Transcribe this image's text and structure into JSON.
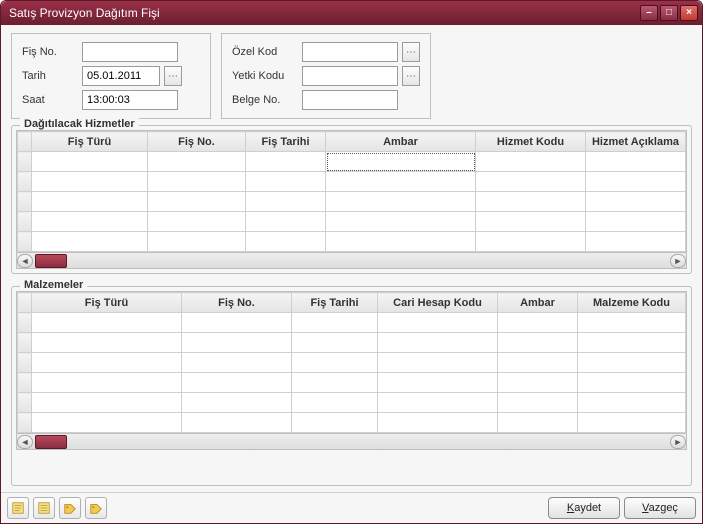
{
  "window": {
    "title": "Satış Provizyon Dağıtım Fişi"
  },
  "form_left": {
    "fis_no": {
      "label": "Fiş No.",
      "value": ""
    },
    "tarih": {
      "label": "Tarih",
      "value": "05.01.2011"
    },
    "saat": {
      "label": "Saat",
      "value": "13:00:03"
    }
  },
  "form_right": {
    "ozel_kod": {
      "label": "Özel Kod",
      "value": ""
    },
    "yetki_kodu": {
      "label": "Yetki Kodu",
      "value": ""
    },
    "belge_no": {
      "label": "Belge No.",
      "value": ""
    }
  },
  "grid_hizmetler": {
    "title": "Dağıtılacak Hizmetler",
    "columns": [
      "Fiş Türü",
      "Fiş No.",
      "Fiş Tarihi",
      "Ambar",
      "Hizmet Kodu",
      "Hizmet Açıklama"
    ]
  },
  "grid_malzemeler": {
    "title": "Malzemeler",
    "columns": [
      "Fiş Türü",
      "Fiş No.",
      "Fiş Tarihi",
      "Cari Hesap Kodu",
      "Ambar",
      "Malzeme Kodu"
    ]
  },
  "buttons": {
    "kaydet_prefix": "K",
    "kaydet_rest": "aydet",
    "vazgec_prefix": "V",
    "vazgec_rest": "azgeç"
  }
}
